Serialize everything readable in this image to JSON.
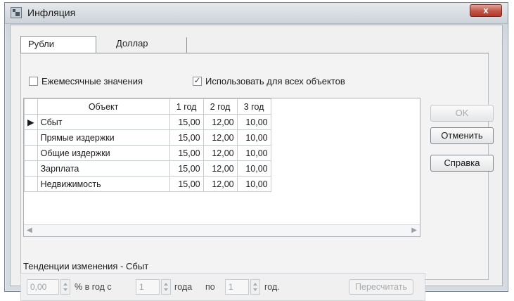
{
  "window": {
    "title": "Инфляция",
    "close_label": "x"
  },
  "tabs": [
    {
      "label": "Рубли",
      "active": true
    },
    {
      "label": "Доллар",
      "active": false
    }
  ],
  "options": {
    "monthly_label": "Ежемесячные значения",
    "monthly_checked": false,
    "all_objects_label": "Использовать для всех объектов",
    "all_objects_checked": true,
    "check_mark": "✓"
  },
  "grid": {
    "columns": [
      "Объект",
      "1 год",
      "2 год",
      "3 год"
    ],
    "current_row_marker": "▶",
    "rows": [
      {
        "object": "Сбыт",
        "y1": "15,00",
        "y2": "12,00",
        "y3": "10,00"
      },
      {
        "object": "Прямые издержки",
        "y1": "15,00",
        "y2": "12,00",
        "y3": "10,00"
      },
      {
        "object": "Общие издержки",
        "y1": "15,00",
        "y2": "12,00",
        "y3": "10,00"
      },
      {
        "object": "Зарплата",
        "y1": "15,00",
        "y2": "12,00",
        "y3": "10,00"
      },
      {
        "object": "Недвижимость",
        "y1": "15,00",
        "y2": "12,00",
        "y3": "10,00"
      }
    ],
    "scroll_left": "◀",
    "scroll_right": "▶"
  },
  "buttons": {
    "ok": "OK",
    "cancel": "Отменить",
    "help": "Справка"
  },
  "trend": {
    "label": "Тенденции изменения - Сбыт",
    "rate_value": "0,00",
    "rate_suffix": "% в год с",
    "from_value": "1",
    "from_suffix": "года",
    "to_prefix": "по",
    "to_value": "1",
    "to_suffix": "год.",
    "recalc_label": "Пересчитать"
  }
}
